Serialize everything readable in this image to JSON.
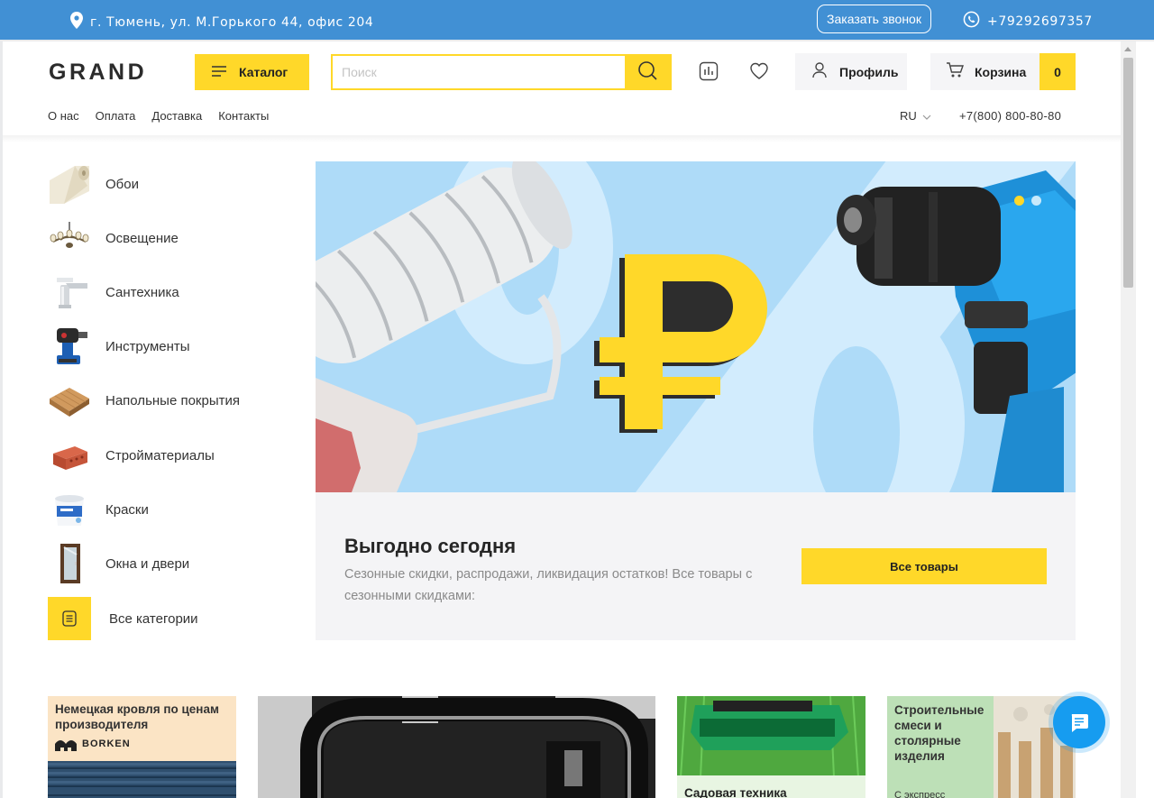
{
  "topbar": {
    "address": "г. Тюмень, ул. М.Горького 44, офис 204",
    "callback_label": "Заказать звонок",
    "phone": "+79292697357"
  },
  "header": {
    "logo": "GRAND",
    "catalog_label": "Каталог",
    "search_placeholder": "Поиск",
    "profile_label": "Профиль",
    "cart_label": "Корзина",
    "cart_count": "0",
    "nav": [
      "О нас",
      "Оплата",
      "Доставка",
      "Контакты"
    ],
    "lang": "RU",
    "phone": "+7(800) 800-80-80"
  },
  "categories": [
    {
      "label": "Обои",
      "icon": "wallpaper-roll-icon"
    },
    {
      "label": "Освещение",
      "icon": "chandelier-icon"
    },
    {
      "label": "Сантехника",
      "icon": "faucet-icon"
    },
    {
      "label": "Инструменты",
      "icon": "drill-icon"
    },
    {
      "label": "Напольные покрытия",
      "icon": "flooring-icon"
    },
    {
      "label": "Стройматериалы",
      "icon": "brick-icon"
    },
    {
      "label": "Краски",
      "icon": "paint-bucket-icon"
    },
    {
      "label": "Окна и двери",
      "icon": "door-icon"
    },
    {
      "label": "Все категории",
      "icon": "list-icon"
    }
  ],
  "banner": {
    "title": "Выгодно сегодня",
    "description": "Сезонные скидки, распродажи, ликвидация остатков! Все товары с сезонными скидками:",
    "button_label": "Все товары",
    "slide_count": 2,
    "active_slide": 1
  },
  "promos": [
    {
      "text": "Немецкая кровля по ценам производителя",
      "brand": "BORKEN"
    },
    {
      "text": ""
    },
    {
      "text": "Садовая техника"
    },
    {
      "text": "Строительные смеси и столярные изделия",
      "subtext": "С экспресс"
    }
  ],
  "colors": {
    "accent": "#ffd829",
    "topbar": "#4190d4",
    "chat": "#169cf0"
  }
}
